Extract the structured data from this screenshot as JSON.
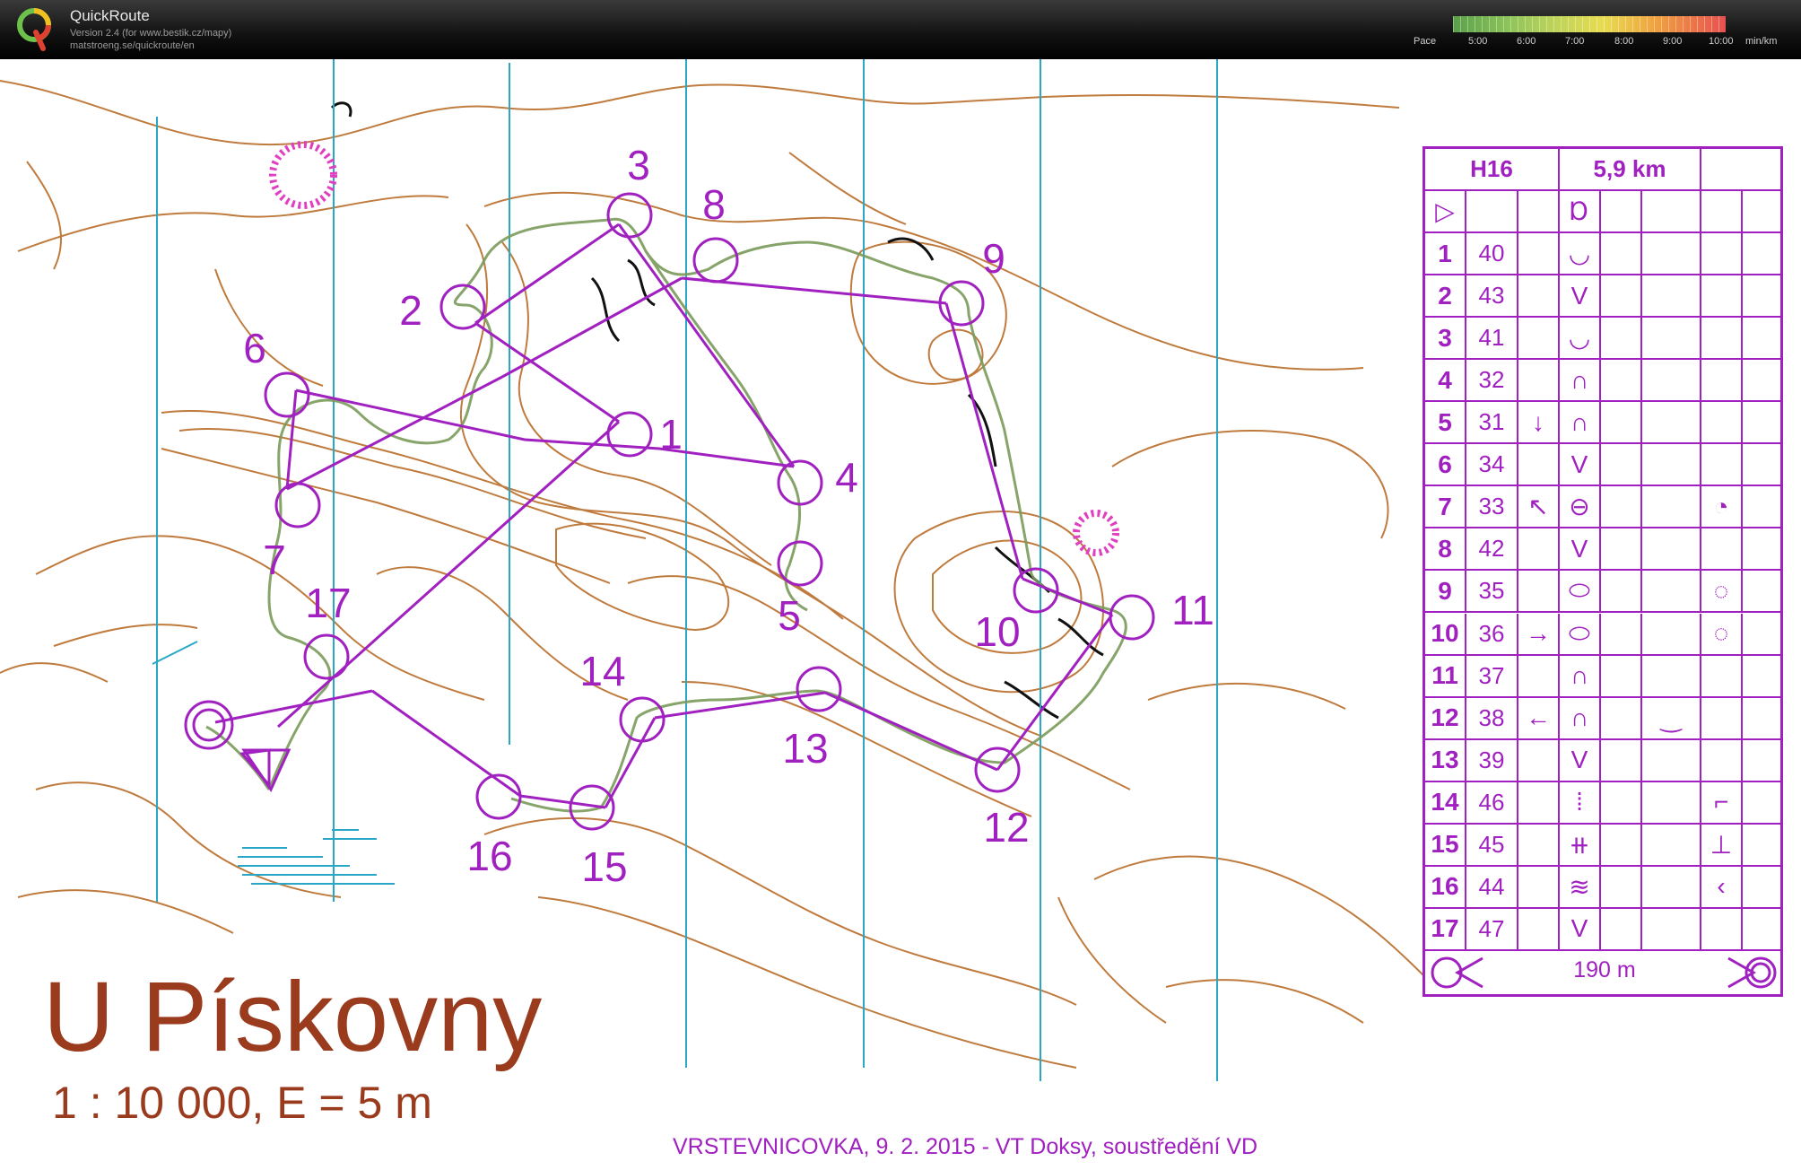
{
  "app": {
    "name": "QuickRoute",
    "version_line": "Version 2.4  (for www.bestik.cz/mapy)",
    "url_line": "matstroeng.se/quickroute/en",
    "logo_letter": "Q"
  },
  "pace_legend": {
    "label": "Pace",
    "ticks": [
      "5:00",
      "6:00",
      "7:00",
      "8:00",
      "9:00",
      "10:00"
    ],
    "unit": "min/km"
  },
  "map": {
    "title": "U Pískovny",
    "scale": "1 : 10 000, E = 5 m",
    "footer": "VRSTEVNICOVKA, 9. 2. 2015 - VT Doksy, soustředění VD",
    "control_labels": [
      "1",
      "2",
      "3",
      "4",
      "5",
      "6",
      "7",
      "8",
      "9",
      "10",
      "11",
      "12",
      "13",
      "14",
      "15",
      "16",
      "17"
    ]
  },
  "control_descriptions": {
    "class": "H16",
    "length": "5,9 km",
    "finish_distance": "190 m",
    "rows": [
      {
        "num": "1",
        "code": "40",
        "dir": "",
        "feature": "◡",
        "extra": ""
      },
      {
        "num": "2",
        "code": "43",
        "dir": "",
        "feature": "V",
        "extra": ""
      },
      {
        "num": "3",
        "code": "41",
        "dir": "",
        "feature": "◡",
        "extra": ""
      },
      {
        "num": "4",
        "code": "32",
        "dir": "",
        "feature": "∩",
        "extra": ""
      },
      {
        "num": "5",
        "code": "31",
        "dir": "↓",
        "feature": "∩",
        "extra": ""
      },
      {
        "num": "6",
        "code": "34",
        "dir": "",
        "feature": "V",
        "extra": ""
      },
      {
        "num": "7",
        "code": "33",
        "dir": "↖",
        "feature": "⊖",
        "extra": "◔"
      },
      {
        "num": "8",
        "code": "42",
        "dir": "",
        "feature": "V",
        "extra": ""
      },
      {
        "num": "9",
        "code": "35",
        "dir": "",
        "feature": "⬭",
        "extra": "◌"
      },
      {
        "num": "10",
        "code": "36",
        "dir": "→",
        "feature": "⬭",
        "extra": "◌"
      },
      {
        "num": "11",
        "code": "37",
        "dir": "",
        "feature": "∩",
        "extra": ""
      },
      {
        "num": "12",
        "code": "38",
        "dir": "←",
        "feature": "∩",
        "extra": "‿"
      },
      {
        "num": "13",
        "code": "39",
        "dir": "",
        "feature": "V",
        "extra": ""
      },
      {
        "num": "14",
        "code": "46",
        "dir": "",
        "feature": "⁞",
        "extra": "⌐"
      },
      {
        "num": "15",
        "code": "45",
        "dir": "",
        "feature": "⧺",
        "extra": "⊥"
      },
      {
        "num": "16",
        "code": "44",
        "dir": "",
        "feature": "≋",
        "extra": "‹"
      },
      {
        "num": "17",
        "code": "47",
        "dir": "",
        "feature": "V",
        "extra": ""
      }
    ]
  },
  "colors": {
    "course": "#a020c0",
    "contour": "#b5651d",
    "grid": "#2aa7c7",
    "title": "#9a3b1e"
  }
}
